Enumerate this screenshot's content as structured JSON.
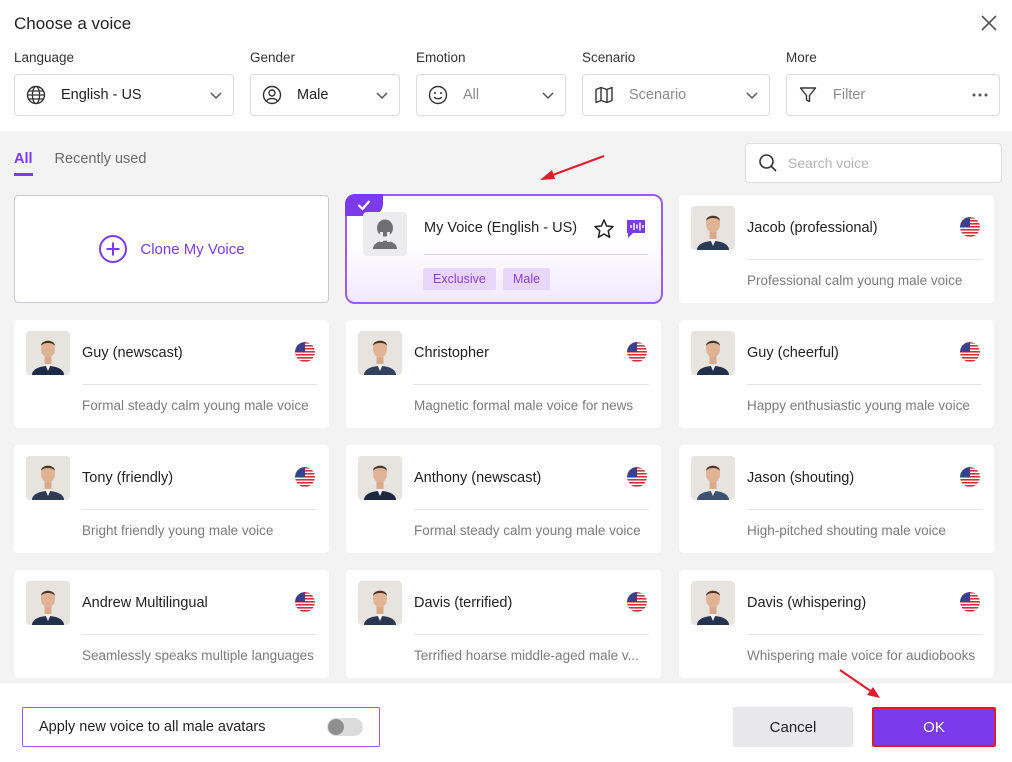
{
  "dialog": {
    "title": "Choose a voice"
  },
  "filters": {
    "language": {
      "label": "Language",
      "value": "English - US"
    },
    "gender": {
      "label": "Gender",
      "value": "Male"
    },
    "emotion": {
      "label": "Emotion",
      "value": "All"
    },
    "scenario": {
      "label": "Scenario",
      "value": "Scenario"
    },
    "more": {
      "label": "More",
      "value": "Filter"
    }
  },
  "tabs": [
    {
      "label": "All",
      "active": true
    },
    {
      "label": "Recently used",
      "active": false
    }
  ],
  "search": {
    "placeholder": "Search voice"
  },
  "clone": {
    "label": "Clone My Voice"
  },
  "my_voice": {
    "name": "My Voice (English - US)",
    "tags": [
      "Exclusive",
      "Male"
    ],
    "selected": true
  },
  "voices": [
    {
      "name": "Jacob (professional)",
      "desc": "Professional calm young male voice"
    },
    {
      "name": "Guy (newscast)",
      "desc": "Formal steady calm young male voice"
    },
    {
      "name": "Christopher",
      "desc": "Magnetic formal male voice for news"
    },
    {
      "name": "Guy (cheerful)",
      "desc": "Happy enthusiastic young male voice"
    },
    {
      "name": "Tony (friendly)",
      "desc": "Bright friendly young male voice"
    },
    {
      "name": "Anthony (newscast)",
      "desc": "Formal steady calm young male voice"
    },
    {
      "name": "Jason (shouting)",
      "desc": "High-pitched shouting male voice"
    },
    {
      "name": "Andrew Multilingual",
      "desc": "Seamlessly speaks multiple languages"
    },
    {
      "name": "Davis (terrified)",
      "desc": "Terrified hoarse middle-aged male v..."
    },
    {
      "name": "Davis (whispering)",
      "desc": "Whispering male voice for audiobooks"
    }
  ],
  "footer": {
    "apply_label": "Apply new voice to all male avatars",
    "apply_enabled": false,
    "cancel_label": "Cancel",
    "ok_label": "OK"
  },
  "colors": {
    "accent": "#7c3aed",
    "highlight": "#e21b2c"
  }
}
